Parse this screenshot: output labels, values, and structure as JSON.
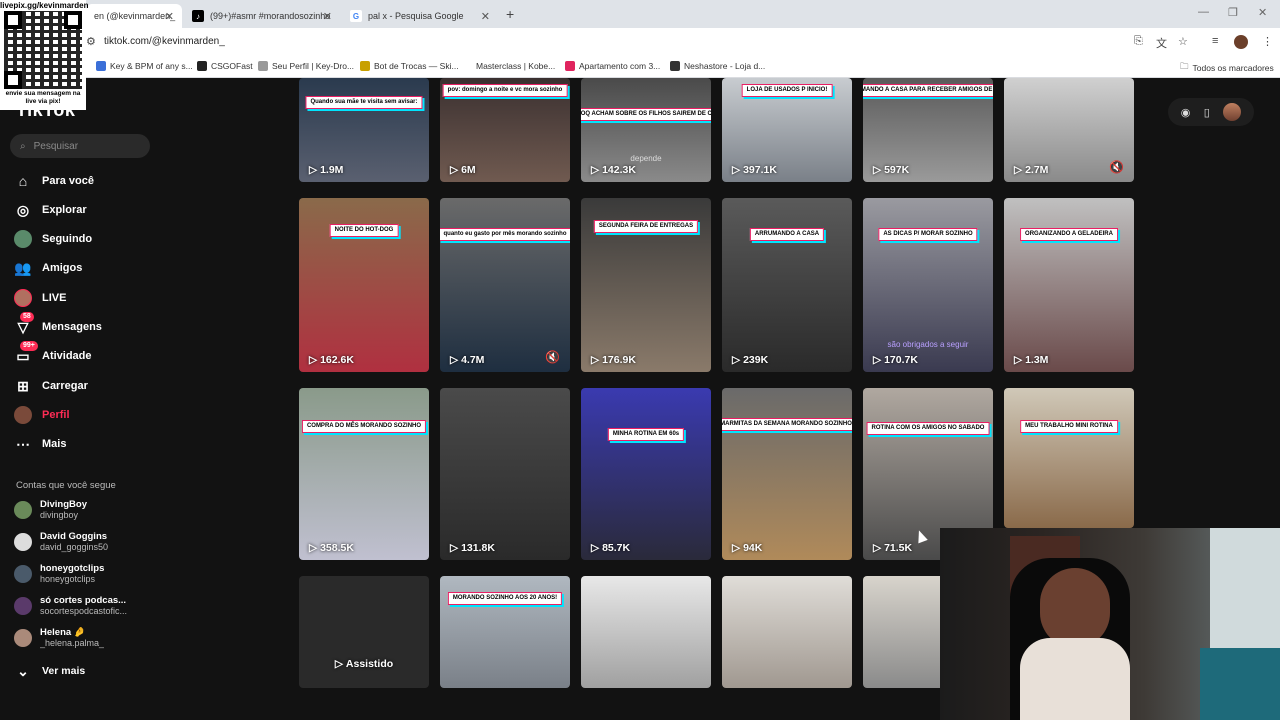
{
  "browser": {
    "tabs": [
      {
        "title": "en (@kevinmarden_",
        "active": true
      },
      {
        "title": "(99+)#asmr #morandosozinho",
        "active": false
      },
      {
        "title": "pal x - Pesquisa Google",
        "active": false
      }
    ],
    "url": "tiktok.com/@kevinmarden_",
    "bookmarks": [
      "Key & BPM of any s...",
      "CSGOFast",
      "Seu Perfil | Key-Dro...",
      "Bot de Trocas — Ski...",
      "Masterclass | Kobe...",
      "Apartamento com 3...",
      "Neshastore - Loja d..."
    ],
    "all_bookmarks": "Todos os marcadores"
  },
  "qr": {
    "top": "livepix.gg/kevinmarden",
    "bottom": "envie sua mensagem na live via pix!"
  },
  "tiktok": {
    "logo": "TikTok",
    "search_placeholder": "Pesquisar",
    "nav": [
      {
        "label": "Para você",
        "icon": "home-icon"
      },
      {
        "label": "Explorar",
        "icon": "compass-icon"
      },
      {
        "label": "Seguindo",
        "icon": "following-avatar"
      },
      {
        "label": "Amigos",
        "icon": "friends-icon"
      },
      {
        "label": "LIVE",
        "icon": "live-avatar"
      },
      {
        "label": "Mensagens",
        "icon": "message-icon",
        "badge": "58"
      },
      {
        "label": "Atividade",
        "icon": "activity-icon",
        "badge": "99+"
      },
      {
        "label": "Carregar",
        "icon": "upload-icon"
      },
      {
        "label": "Perfil",
        "icon": "profile-avatar"
      },
      {
        "label": "Mais",
        "icon": "more-icon"
      }
    ],
    "following_title": "Contas que você segue",
    "accounts": [
      {
        "name": "DivingBoy",
        "user": "divingboy"
      },
      {
        "name": "David Goggins",
        "user": "david_goggins50"
      },
      {
        "name": "honeygotclips",
        "user": "honeygotclips"
      },
      {
        "name": "só cortes podcas...",
        "user": "socortespodcastofic..."
      },
      {
        "name": "Helena 🤌",
        "user": "_helena.palma_"
      }
    ],
    "see_more": "Ver mais"
  },
  "videos": [
    {
      "views": "1.9M",
      "caption": "Quando sua mãe te visita sem avisar:"
    },
    {
      "views": "6M",
      "caption": "pov: domingo a noite e vc mora sozinho"
    },
    {
      "views": "142.3K",
      "caption": "PAIS, OQ ACHAM SOBRE OS FILHOS SAIREM DE CASA?",
      "sub": "depende"
    },
    {
      "views": "397.1K",
      "caption": "LOJA DE USADOS P INICIO!"
    },
    {
      "views": "597K",
      "caption": "ARRUMANDO A CASA PARA RECEBER AMIGOS DE NOITE"
    },
    {
      "views": "2.7M",
      "caption": "",
      "muted": true
    },
    {
      "views": "162.6K",
      "caption": "NOITE DO HOT-DOG"
    },
    {
      "views": "4.7M",
      "caption": "quanto eu gasto por mês morando sozinho",
      "muted": true
    },
    {
      "views": "176.9K",
      "caption": "SEGUNDA FEIRA DE ENTREGAS"
    },
    {
      "views": "239K",
      "caption": "ARRUMANDO A CASA"
    },
    {
      "views": "170.7K",
      "caption": "AS DICAS P/ MORAR SOZINHO",
      "sub": "são obrigados a seguir"
    },
    {
      "views": "1.3M",
      "caption": "ORGANIZANDO A GELADEIRA"
    },
    {
      "views": "358.5K",
      "caption": "COMPRA DO MÊS MORANDO SOZINHO"
    },
    {
      "views": "131.8K",
      "caption": ""
    },
    {
      "views": "85.7K",
      "caption": "MINHA ROTINA EM 60s"
    },
    {
      "views": "94K",
      "caption": "MARMITAS DA SEMANA MORANDO SOZINHO!"
    },
    {
      "views": "71.5K",
      "caption": "ROTINA COM OS AMIGOS NO SABADO"
    },
    {
      "views": "",
      "caption": "MEU TRABALHO MINI ROTINA"
    },
    {
      "views": "Assistido",
      "caption": ""
    },
    {
      "views": "",
      "caption": "MORANDO SOZINHO AOS 20 ANOS!"
    },
    {
      "views": "",
      "caption": ""
    },
    {
      "views": "",
      "caption": ""
    },
    {
      "views": "",
      "caption": ""
    }
  ],
  "colors": {
    "accent": "#fe2c55",
    "bg": "#121212"
  }
}
